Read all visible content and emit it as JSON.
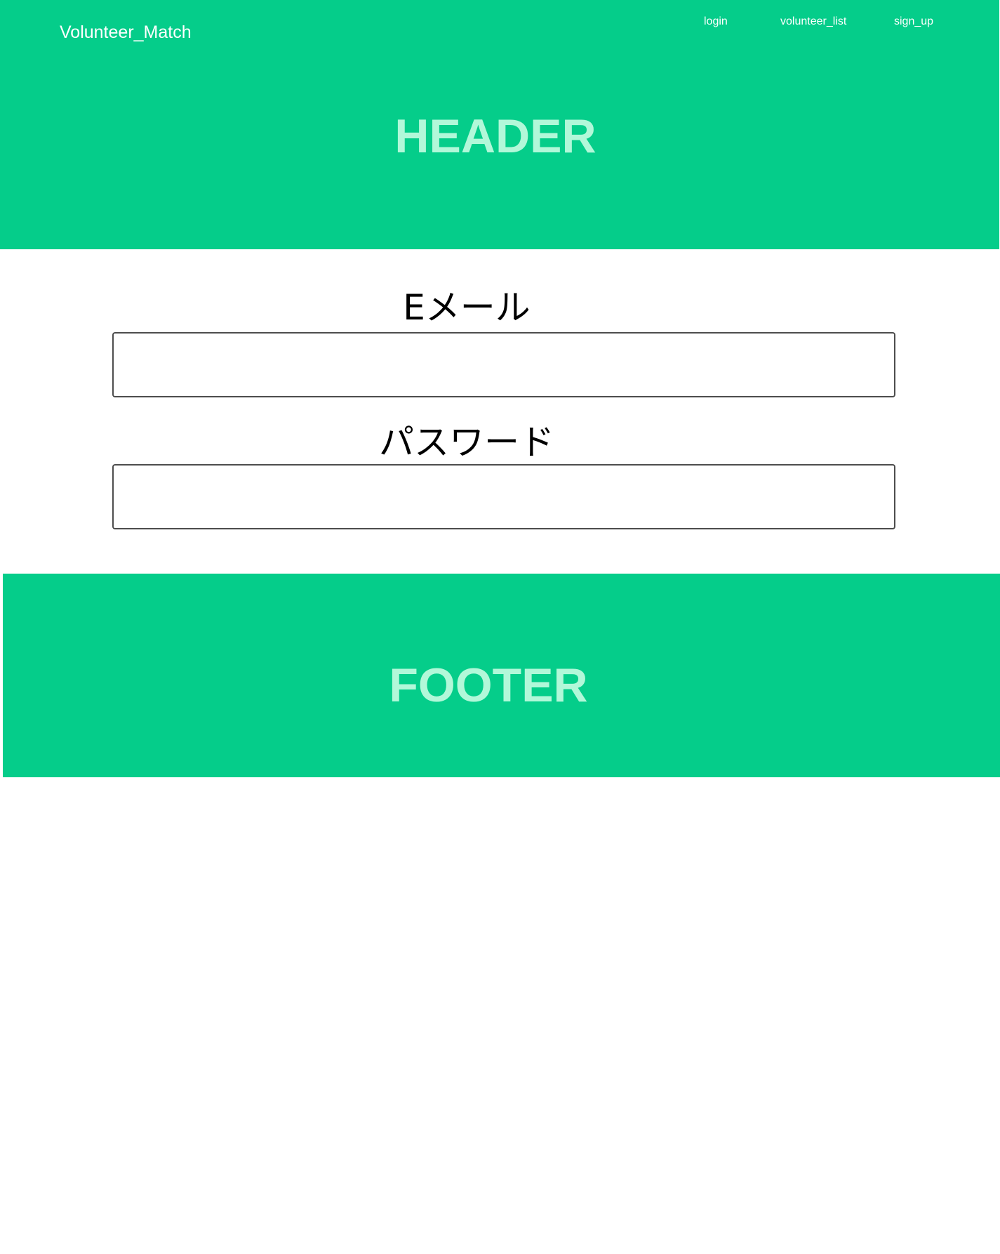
{
  "header": {
    "brand": "Volunteer_Match",
    "nav": [
      {
        "label": "login"
      },
      {
        "label": "volunteer_list"
      },
      {
        "label": "sign_up"
      }
    ],
    "title": "HEADER"
  },
  "form": {
    "email_label": "Eメール",
    "email_value": "",
    "password_label": "パスワード",
    "password_value": ""
  },
  "footer": {
    "title": "FOOTER"
  },
  "colors": {
    "accent_green": "#05cd8a",
    "header_text": "#b2f8d9",
    "input_border": "#4d4d4d"
  }
}
